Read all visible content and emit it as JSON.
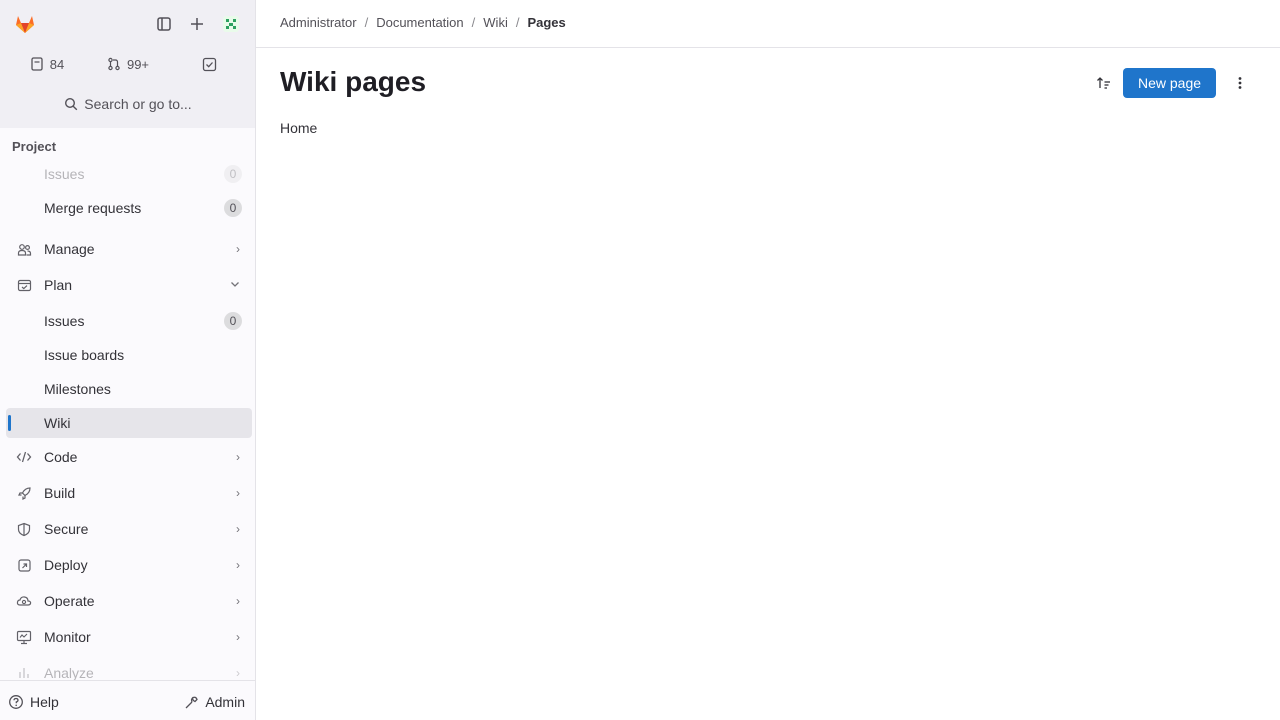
{
  "colors": {
    "accent": "#1f75cb",
    "sidebar_bg": "#fbfafd",
    "active_item_bg": "#e6e5ea"
  },
  "sidebar": {
    "counters": {
      "issues": "84",
      "merge_requests": "99+"
    },
    "search_label": "Search or go to...",
    "section_title": "Project",
    "items": [
      {
        "label": "Issues",
        "badge": "0",
        "icon": "issues-icon"
      },
      {
        "label": "Merge requests",
        "badge": "0",
        "icon": "merge-request-icon"
      },
      {
        "label": "Manage",
        "icon": "users-icon"
      },
      {
        "label": "Plan",
        "icon": "plan-icon"
      },
      {
        "label": "Issues",
        "badge": "0"
      },
      {
        "label": "Issue boards"
      },
      {
        "label": "Milestones"
      },
      {
        "label": "Wiki"
      },
      {
        "label": "Code",
        "icon": "code-icon"
      },
      {
        "label": "Build",
        "icon": "rocket-icon"
      },
      {
        "label": "Secure",
        "icon": "shield-icon"
      },
      {
        "label": "Deploy",
        "icon": "deploy-icon"
      },
      {
        "label": "Operate",
        "icon": "cloud-gear-icon"
      },
      {
        "label": "Monitor",
        "icon": "monitor-icon"
      },
      {
        "label": "Analyze",
        "icon": "chart-icon"
      }
    ],
    "bottom": {
      "help": "Help",
      "admin": "Admin"
    }
  },
  "breadcrumb": [
    "Administrator",
    "Documentation",
    "Wiki",
    "Pages"
  ],
  "main": {
    "title": "Wiki pages",
    "new_page_label": "New page",
    "pages": [
      "Home"
    ]
  }
}
